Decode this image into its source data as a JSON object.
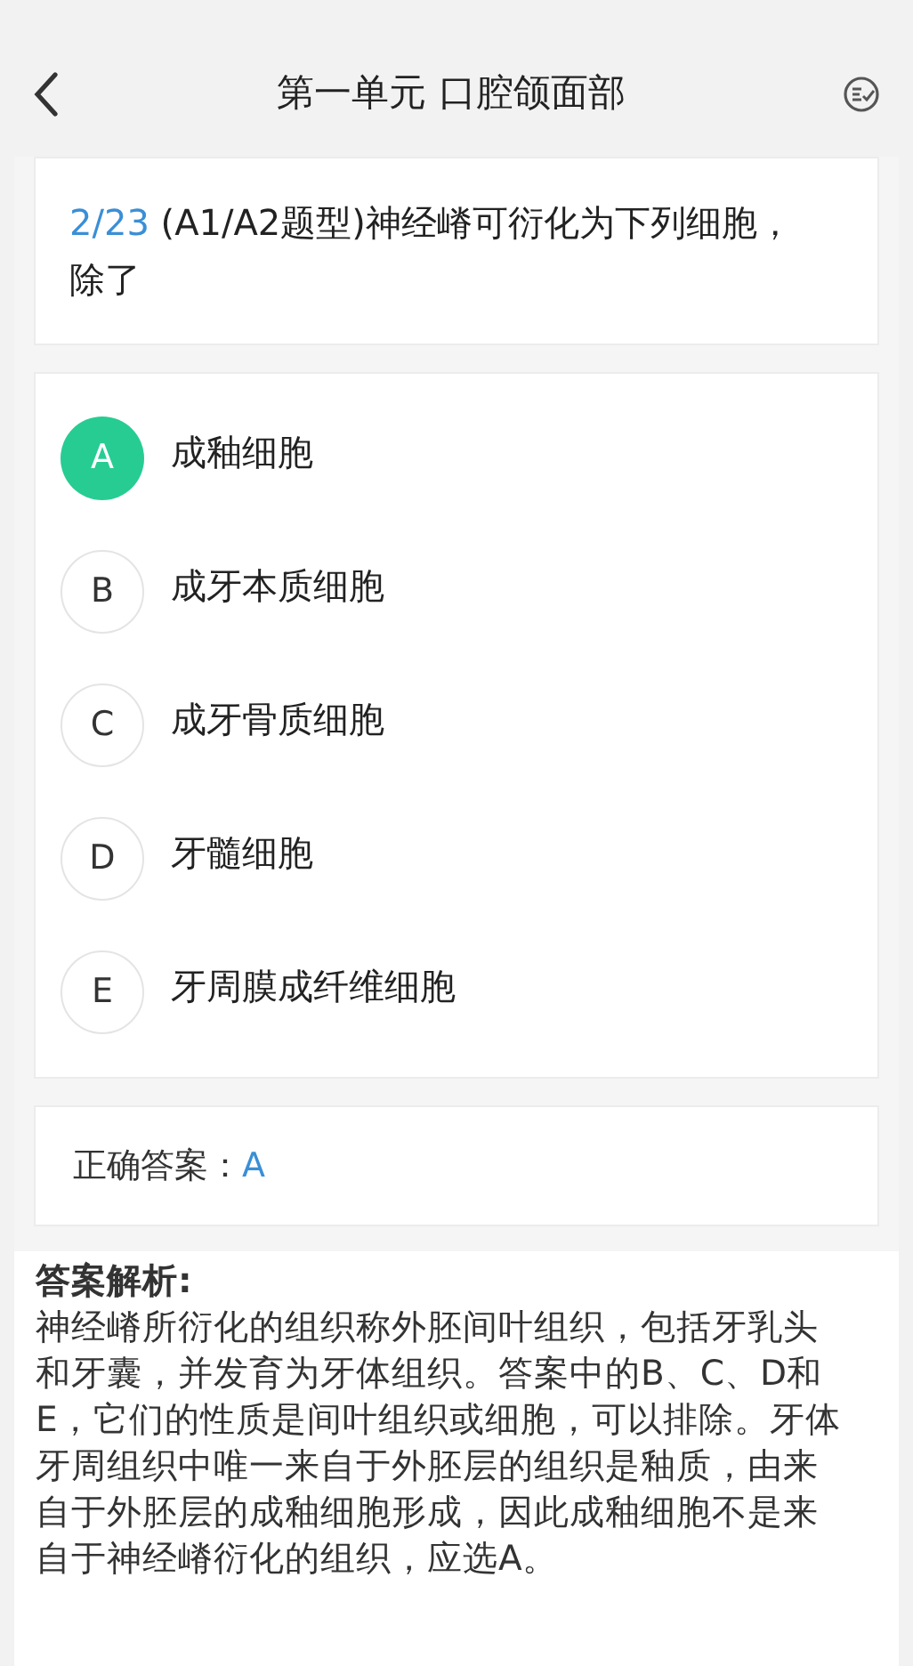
{
  "header": {
    "title": "第一单元 口腔颌面部"
  },
  "question": {
    "number": "2/23",
    "text": "(A1/A2题型)神经嵴可衍化为下列细胞，除了"
  },
  "options": [
    {
      "letter": "A",
      "text": "成釉细胞",
      "selected": true
    },
    {
      "letter": "B",
      "text": "成牙本质细胞",
      "selected": false
    },
    {
      "letter": "C",
      "text": "成牙骨质细胞",
      "selected": false
    },
    {
      "letter": "D",
      "text": "牙髓细胞",
      "selected": false
    },
    {
      "letter": "E",
      "text": "牙周膜成纤维细胞",
      "selected": false
    }
  ],
  "answer": {
    "label": "正确答案：",
    "value": "A"
  },
  "analysis": {
    "title": "答案解析:",
    "text": "神经嵴所衍化的组织称外胚间叶组织，包括牙乳头和牙囊，并发育为牙体组织。答案中的B、C、D和E，它们的性质是间叶组织或细胞，可以排除。牙体牙周组织中唯一来自于外胚层的组织是釉质，由来自于外胚层的成釉细胞形成，因此成釉细胞不是来自于神经嵴衍化的组织，应选A。"
  }
}
